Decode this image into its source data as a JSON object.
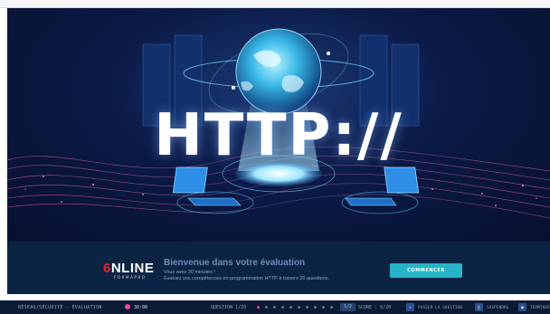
{
  "hero": {
    "title": "HTTP://"
  },
  "welcome": {
    "logo_number": "6",
    "logo_text": "NLINE",
    "logo_sub": "FORMAPRO",
    "title": "Bienvenue dans votre évaluation",
    "line1": "Vous avez 30 minutes !",
    "line2": "Évaluez vos compétences en programmation HTTP à travers 20 questions.",
    "start_button": "COMMENCER"
  },
  "status_bar": {
    "module": "RÉSEAU/SÉCURITÉ - ÉVALUATION",
    "timer": "30:00",
    "question": "QUESTION 1/20",
    "progress": {
      "current": 1,
      "total": 10
    },
    "page_pill": "1/2",
    "score": "SCORE : 0/20",
    "actions": [
      {
        "icon": "skip-icon",
        "glyph": "»",
        "label": "PASSER LA QUESTION"
      },
      {
        "icon": "pause-icon",
        "glyph": "‖",
        "label": "SUSPENDRE"
      },
      {
        "icon": "stop-icon",
        "glyph": "■",
        "label": "TERMINER"
      }
    ]
  },
  "colors": {
    "accent": "#27b4c8",
    "timer_dot": "#ff3fa5",
    "panel": "#0c2443",
    "status_bg": "#0a1b33"
  }
}
